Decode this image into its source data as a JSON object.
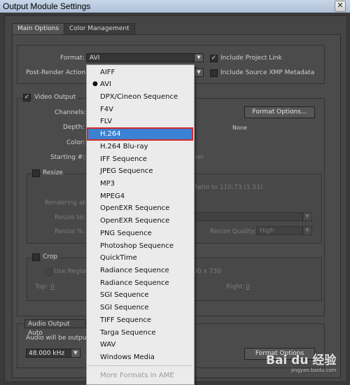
{
  "window": {
    "title": "Output Module Settings",
    "close_glyph": "✕"
  },
  "tabs": [
    {
      "label": "Main Options"
    },
    {
      "label": "Color Management"
    }
  ],
  "format": {
    "label": "Format:",
    "value": "AVI",
    "post_render_label": "Post-Render Action:",
    "include_project_link": "Include Project Link",
    "include_xmp": "Include Source XMP Metadata"
  },
  "video": {
    "label": "Video Output",
    "channels_label": "Channels:",
    "depth_label": "Depth:",
    "color_label": "Color:",
    "starting_label": "Starting #:",
    "format_options": "Format Options...",
    "none_text": "None",
    "partial_per": "per"
  },
  "resize": {
    "label": "Resize",
    "rendering_at": "Rendering at:",
    "resize_to": "Resize to:",
    "resize_pct": "Resize %:",
    "ratio_text": "Ratio to 110:73 (1.51)",
    "quality_label": "Resize Quality:",
    "quality_value": "High"
  },
  "crop": {
    "label": "Crop",
    "use_region": "Use Region",
    "dims_text": "00 x 730",
    "top_label": "Top:",
    "top_value": "0",
    "right_label": "Right:",
    "right_value": "0"
  },
  "audio": {
    "auto_label": "Audio Output Auto",
    "will_be": "Audio will be output o",
    "rate": "48.000 kHz",
    "format_options": "Format Options"
  },
  "watermark": {
    "text": "Bai du 经验",
    "subtext": "jingyan.baidu.com"
  },
  "dropdown": {
    "items": [
      {
        "label": "AIFF"
      },
      {
        "label": "AVI"
      },
      {
        "label": "DPX/Cineon Sequence"
      },
      {
        "label": "F4V"
      },
      {
        "label": "FLV"
      },
      {
        "label": "H.264"
      },
      {
        "label": "H.264 Blu-ray"
      },
      {
        "label": "IFF Sequence"
      },
      {
        "label": "JPEG Sequence"
      },
      {
        "label": "MP3"
      },
      {
        "label": "MPEG4"
      },
      {
        "label": "OpenEXR Sequence"
      },
      {
        "label": "OpenEXR Sequence"
      },
      {
        "label": "PNG Sequence"
      },
      {
        "label": "Photoshop Sequence"
      },
      {
        "label": "QuickTime"
      },
      {
        "label": "Radiance Sequence"
      },
      {
        "label": "Radiance Sequence"
      },
      {
        "label": "SGI Sequence"
      },
      {
        "label": "SGI Sequence"
      },
      {
        "label": "TIFF Sequence"
      },
      {
        "label": "Targa Sequence"
      },
      {
        "label": "WAV"
      },
      {
        "label": "Windows Media"
      }
    ],
    "more": "More Formats in AME",
    "checked_item": "AVI",
    "highlighted_item": "H.264",
    "bullet_glyph": "●"
  },
  "colors": {
    "accent": "#3b82d4",
    "highlight_outline": "#d22a2a"
  }
}
